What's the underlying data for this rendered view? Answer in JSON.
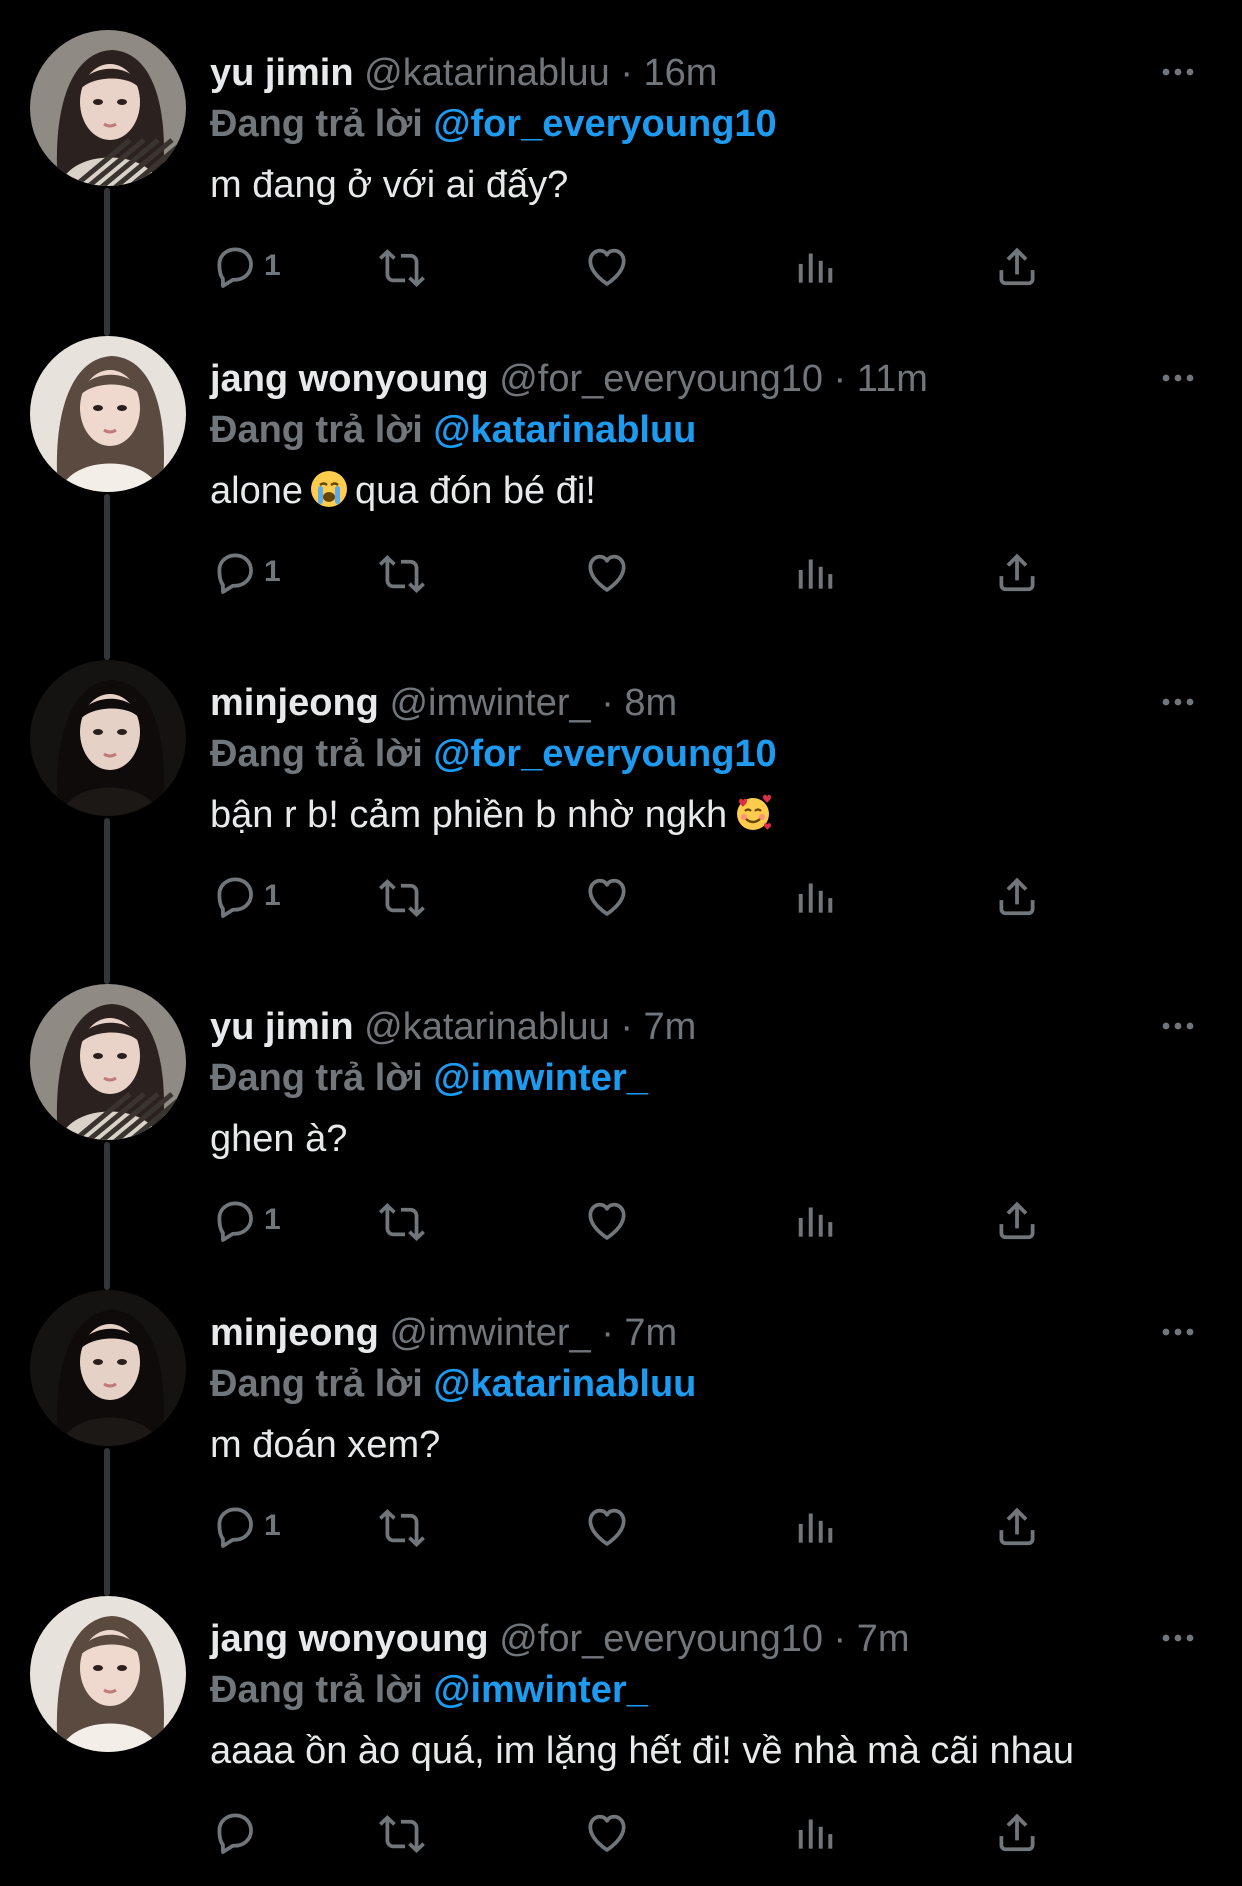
{
  "reply_prefix": "Đang trả lời",
  "tweets": [
    {
      "name": "yu jimin",
      "handle": "@katarinabluu",
      "separator": "·",
      "time": "16m",
      "reply_to": "@for_everyoung10",
      "text_before": "m đang ở với ai đấy?",
      "emoji": "",
      "text_after": "",
      "reply_count": "1"
    },
    {
      "name": "jang wonyoung",
      "handle": "@for_everyoung10",
      "separator": "·",
      "time": "11m",
      "reply_to": "@katarinabluu",
      "text_before": "alone",
      "emoji": "loudly-crying-face",
      "text_after": "qua đón bé đi!",
      "reply_count": "1"
    },
    {
      "name": "minjeong",
      "handle": "@imwinter_",
      "separator": "·",
      "time": "8m",
      "reply_to": "@for_everyoung10",
      "text_before": "bận r b! cảm phiền b nhờ ngkh",
      "emoji": "smiling-face-with-hearts",
      "text_after": "",
      "reply_count": "1"
    },
    {
      "name": "yu jimin",
      "handle": "@katarinabluu",
      "separator": "·",
      "time": "7m",
      "reply_to": "@imwinter_",
      "text_before": "ghen à?",
      "emoji": "",
      "text_after": "",
      "reply_count": "1"
    },
    {
      "name": "minjeong",
      "handle": "@imwinter_",
      "separator": "·",
      "time": "7m",
      "reply_to": "@katarinabluu",
      "text_before": "m đoán xem?",
      "emoji": "",
      "text_after": "",
      "reply_count": "1"
    },
    {
      "name": "jang wonyoung",
      "handle": "@for_everyoung10",
      "separator": "·",
      "time": "7m",
      "reply_to": "@imwinter_",
      "text_before": "aaaa ồn ào quá, im lặng hết đi! về nhà mà cãi nhau",
      "emoji": "",
      "text_after": "",
      "reply_count": ""
    }
  ],
  "colors": {
    "background": "#000000",
    "primary_text": "#e7e9ea",
    "secondary_text": "#71767b",
    "accent": "#1d9bf0",
    "thread_line": "#333639"
  },
  "icons": [
    "reply-icon",
    "retweet-icon",
    "like-icon",
    "views-icon",
    "share-icon",
    "more-icon"
  ]
}
